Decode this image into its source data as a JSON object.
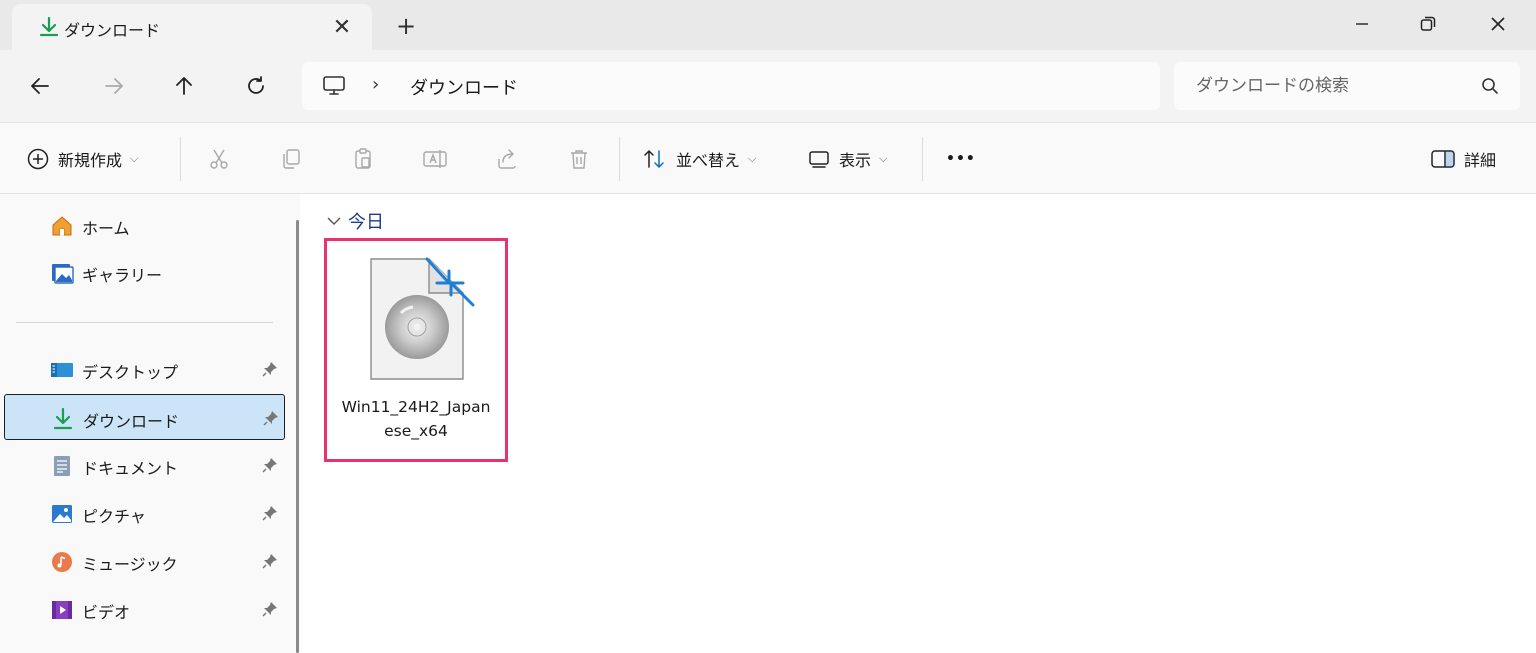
{
  "tab": {
    "title": "ダウンロード",
    "close": "✕",
    "new_tab": "+"
  },
  "window": {
    "minimize": "—",
    "maximize": "❐",
    "close": "✕"
  },
  "nav": {
    "back": "←",
    "forward": "→",
    "up": "↑",
    "refresh": "↻"
  },
  "address": {
    "separator": "›",
    "crumb": "ダウンロード"
  },
  "search": {
    "placeholder": "ダウンロードの検索"
  },
  "commands": {
    "new": "新規作成",
    "sort": "並べ替え",
    "view": "表示",
    "more": "•••",
    "details": "詳細"
  },
  "sidebar": {
    "items": [
      {
        "label": "ホーム",
        "icon": "home-icon",
        "pinned": false
      },
      {
        "label": "ギャラリー",
        "icon": "gallery-icon",
        "pinned": false
      },
      {
        "label": "デスクトップ",
        "icon": "desktop-icon",
        "pinned": true
      },
      {
        "label": "ダウンロード",
        "icon": "download-icon",
        "pinned": true,
        "selected": true
      },
      {
        "label": "ドキュメント",
        "icon": "documents-icon",
        "pinned": true
      },
      {
        "label": "ピクチャ",
        "icon": "pictures-icon",
        "pinned": true
      },
      {
        "label": "ミュージック",
        "icon": "music-icon",
        "pinned": true
      },
      {
        "label": "ビデオ",
        "icon": "videos-icon",
        "pinned": true
      }
    ]
  },
  "content": {
    "group": "今日",
    "files": [
      {
        "name": "Win11_24H2_Japanese_x64",
        "type": "disc-image"
      }
    ]
  },
  "colors": {
    "accent": "#0f6cbd",
    "highlight": "#e8336e",
    "selected_bg": "#cce4f7",
    "download_green": "#1a9e55"
  }
}
